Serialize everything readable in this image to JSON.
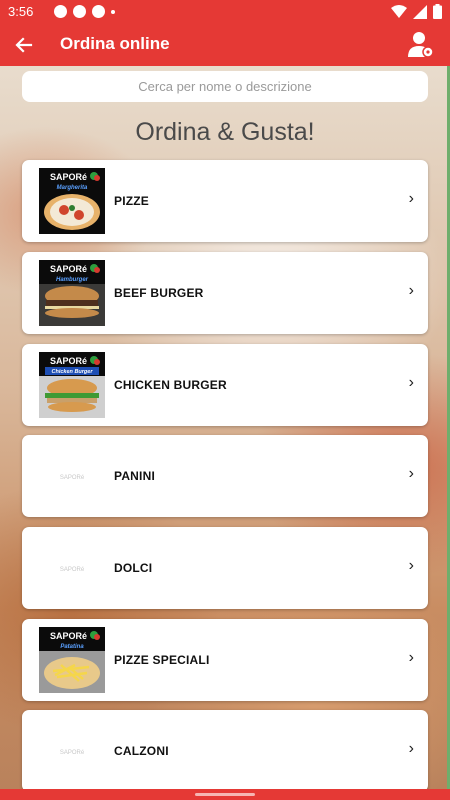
{
  "status_bar": {
    "time": "3:56"
  },
  "app_bar": {
    "title": "Ordina online",
    "back_icon": "arrow-left-icon",
    "user_icon": "user-settings-icon"
  },
  "search": {
    "placeholder": "Cerca per nome o descrizione"
  },
  "heading": "Ordina & Gusta!",
  "colors": {
    "primary": "#e53935",
    "card": "#ffffff",
    "text": "#111111"
  },
  "categories": [
    {
      "label": "PIZZE",
      "thumb": "Margherita"
    },
    {
      "label": "BEEF BURGER",
      "thumb": "Hamburger"
    },
    {
      "label": "CHICKEN BURGER",
      "thumb": "Chicken Burger"
    },
    {
      "label": "PANINI",
      "thumb": ""
    },
    {
      "label": "DOLCI",
      "thumb": ""
    },
    {
      "label": "PIZZE SPECIALI",
      "thumb": "Patatina"
    },
    {
      "label": "CALZONI",
      "thumb": ""
    }
  ],
  "chevron": "›"
}
